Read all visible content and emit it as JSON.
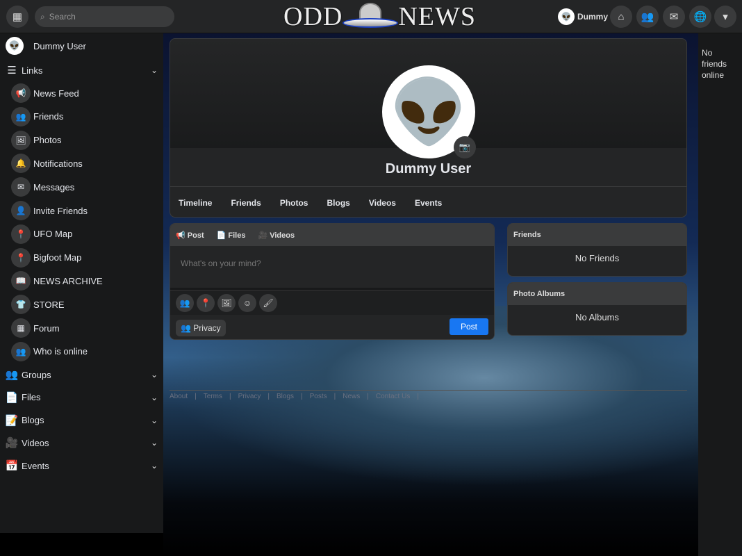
{
  "header": {
    "search_placeholder": "Search",
    "logo_left": "ODD",
    "logo_right": "NEWS",
    "user_name": "Dummy"
  },
  "sidebar": {
    "user_name": "Dummy User",
    "links_label": "Links",
    "items": [
      {
        "label": "News Feed",
        "icon": "📢"
      },
      {
        "label": "Friends",
        "icon": "👥"
      },
      {
        "label": "Photos",
        "icon": "🖼"
      },
      {
        "label": "Notifications",
        "icon": "🔔"
      },
      {
        "label": "Messages",
        "icon": "✉"
      },
      {
        "label": "Invite Friends",
        "icon": "👤"
      },
      {
        "label": "UFO Map",
        "icon": "📍"
      },
      {
        "label": "Bigfoot Map",
        "icon": "📍"
      },
      {
        "label": "NEWS ARCHIVE",
        "icon": "📖"
      },
      {
        "label": "STORE",
        "icon": "👕"
      },
      {
        "label": "Forum",
        "icon": "▦"
      },
      {
        "label": "Who is online",
        "icon": "👥"
      }
    ],
    "groups": [
      {
        "label": "Groups",
        "icon": "👥"
      },
      {
        "label": "Files",
        "icon": "📄"
      },
      {
        "label": "Blogs",
        "icon": "📝"
      },
      {
        "label": "Videos",
        "icon": "🎥"
      },
      {
        "label": "Events",
        "icon": "📅"
      }
    ]
  },
  "profile": {
    "name": "Dummy User",
    "tabs": [
      "Timeline",
      "Friends",
      "Photos",
      "Blogs",
      "Videos",
      "Events"
    ]
  },
  "publisher": {
    "tabs": [
      "Post",
      "Files",
      "Videos"
    ],
    "placeholder": "What's on your mind?",
    "privacy": "Privacy",
    "post_button": "Post"
  },
  "widgets": {
    "friends_title": "Friends",
    "friends_empty": "No Friends",
    "albums_title": "Photo Albums",
    "albums_empty": "No Albums"
  },
  "right": {
    "status": "No friends online"
  },
  "footer": [
    "About",
    "Terms",
    "Privacy",
    "Blogs",
    "Posts",
    "News",
    "Contact Us"
  ]
}
